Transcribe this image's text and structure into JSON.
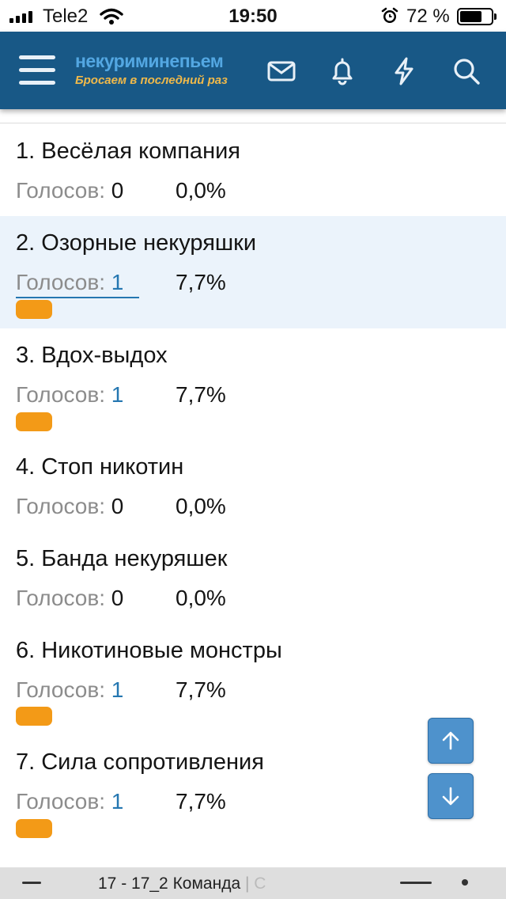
{
  "status_bar": {
    "carrier": "Tele2",
    "time": "19:50",
    "battery_percent": "72 %",
    "battery_level": 0.72
  },
  "header": {
    "logo_main": "некуриминепьем",
    "logo_sub": "Бросаем в последний раз",
    "accent_color": "#185886",
    "icons": [
      "menu-icon",
      "mail-icon",
      "bell-icon",
      "lightning-icon",
      "search-icon"
    ]
  },
  "poll": {
    "votes_label": "Голосов:",
    "items": [
      {
        "title": "1. Весёлая компания",
        "votes": "0",
        "percent": "0,0%",
        "fraction": 0.0
      },
      {
        "title": "2. Озорные некуряшки",
        "votes": "1",
        "percent": "7,7%",
        "fraction": 0.077
      },
      {
        "title": "3. Вдох-выдох",
        "votes": "1",
        "percent": "7,7%",
        "fraction": 0.077
      },
      {
        "title": "4. Стоп никотин",
        "votes": "0",
        "percent": "0,0%",
        "fraction": 0.0
      },
      {
        "title": "5. Банда некуряшек",
        "votes": "0",
        "percent": "0,0%",
        "fraction": 0.0
      },
      {
        "title": "6. Никотиновые монстры",
        "votes": "1",
        "percent": "7,7%",
        "fraction": 0.077
      },
      {
        "title": "7. Сила сопротивления",
        "votes": "1",
        "percent": "7,7%",
        "fraction": 0.077
      }
    ],
    "bar_color": "#f39a17"
  },
  "scroll_buttons": {
    "up_icon": "arrow-up-icon",
    "down_icon": "arrow-down-icon"
  },
  "bottom_bar": {
    "tab_title": "17 - 17_2 Команда",
    "tab_title_overflow": "С"
  }
}
